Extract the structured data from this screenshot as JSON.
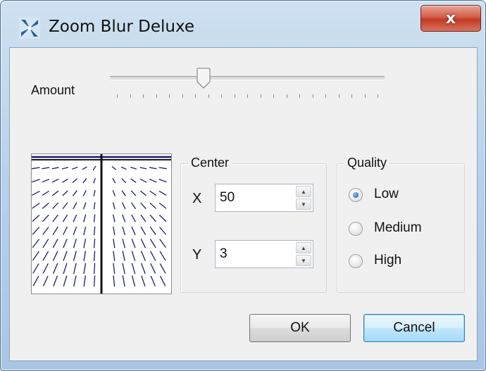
{
  "window": {
    "title": "Zoom Blur Deluxe",
    "close_label": "x",
    "app_icon": "zoom-blur-icon"
  },
  "amount": {
    "label": "Amount",
    "value_fraction": 0.34
  },
  "center": {
    "group_title": "Center",
    "x_label": "X",
    "x_value": "50",
    "y_label": "Y",
    "y_value": "3"
  },
  "quality": {
    "group_title": "Quality",
    "options": [
      "Low",
      "Medium",
      "High"
    ],
    "selected": "Low"
  },
  "buttons": {
    "ok": "OK",
    "cancel": "Cancel"
  },
  "colors": {
    "accent": "#2d6fb8",
    "title_bar": "#b9d2ea",
    "close_button": "#c23b22",
    "preview_lines": "#1a1a6e"
  }
}
